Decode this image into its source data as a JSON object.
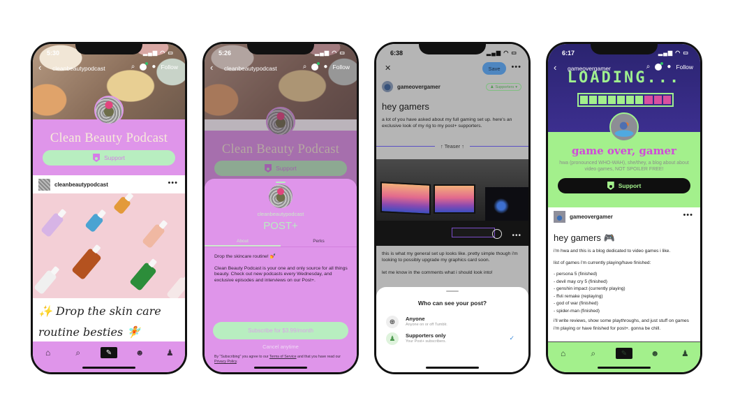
{
  "phones": [
    {
      "status_time": "5:30",
      "nav": {
        "username": "cleanbeautypodcast",
        "follow_label": "Follow"
      },
      "blog_title": "Clean Beauty Podcast",
      "support_label": "Support",
      "post": {
        "author": "cleanbeautypodcast",
        "caption": "✨ Drop the skin care routine besties 🧚"
      },
      "tabbar": [
        "home-icon",
        "search-icon",
        "compose-icon",
        "activity-icon",
        "account-icon"
      ],
      "colors": {
        "blog_bg": "#df95ea",
        "accent": "#b8eec0",
        "title": "#f6ecd9"
      }
    },
    {
      "status_time": "5:26",
      "nav": {
        "username": "cleanbeautypodcast",
        "follow_label": "Follow"
      },
      "blog_title": "Clean Beauty Podcast",
      "support_label": "Support",
      "sheet": {
        "username": "cleanbeautypodcast",
        "heading": "POST+",
        "tabs": [
          {
            "label": "About",
            "active": true
          },
          {
            "label": "Perks",
            "active": false
          }
        ],
        "about_lines": [
          "Drop the skincare routine! 💅",
          "Clean Beauty Podcast is your one and only source for all things beauty. Check out new podcasts every Wednesday, and exclusive episodes and interviews on our Post+."
        ],
        "subscribe_label": "Subscribe for $3.99/month",
        "cancel_label": "Cancel anytime",
        "legal_prefix": "By \"Subscribing\" you agree to our ",
        "terms_label": "Terms of Service",
        "legal_middle": " and that you have read our ",
        "privacy_label": "Privacy Policy",
        "legal_suffix": "."
      }
    },
    {
      "status_time": "6:38",
      "save_label": "Save",
      "author": "gameovergamer",
      "audience_label": "Supporters",
      "post_title": "hey gamers",
      "intro_text": "a lot of you have asked about my full gaming set up. here's an exclusive look of my rig to my post+ supporters.",
      "teaser_label": "Teaser",
      "body_lines": [
        "this is what my general set up looks like. pretty simple though i'm looking to possibly upgrade my graphics card soon.",
        "let me know in the comments what i should look into!"
      ],
      "visibility_sheet": {
        "question": "Who can see your post?",
        "options": [
          {
            "label": "Anyone",
            "sublabel": "Anyone on or off Tumblr.",
            "icon": "globe-icon",
            "selected": false
          },
          {
            "label": "Supporters only",
            "sublabel": "Your Post+ subscribers.",
            "icon": "supporters-icon",
            "selected": true
          }
        ]
      },
      "colors": {
        "save": "#4e86c0",
        "teaser_line": "#5a4fc5",
        "audience": "#4e9a50"
      }
    },
    {
      "status_time": "6:17",
      "nav": {
        "username": "gameovergamer",
        "follow_label": "Follow"
      },
      "banner_text": "LOADING...",
      "loading_progress": {
        "filled": 7,
        "total": 10
      },
      "blog_title": "game over, gamer",
      "blog_description": "hwa (pronounced WHO-WAH), she/they, a blog about about video games, NOT SPOILER FREE!",
      "support_label": "Support",
      "post": {
        "author": "gameovergamer",
        "title": "hey gamers 🎮",
        "intro": "i'm hwa and this is a blog dedicated to video games i like.",
        "list_heading": "list of games i'm currently playing/have finished:",
        "games": [
          "- persona 5 (finished)",
          "- devil may cry 5 (finished)",
          "- genshin impact (currently playing)",
          "- ffvii remake (replaying)",
          "- god of war (finished)",
          "- spider-man (finished)"
        ],
        "outro": "i'll write reviews, show some playthroughs, and just stuff on games i'm playing or have finished for post+. gonna be chill."
      },
      "colors": {
        "banner": "#3c2f8f",
        "accent": "#a3f08c",
        "title": "#d04ad9",
        "progress_empty": "#d94fa0"
      }
    }
  ]
}
